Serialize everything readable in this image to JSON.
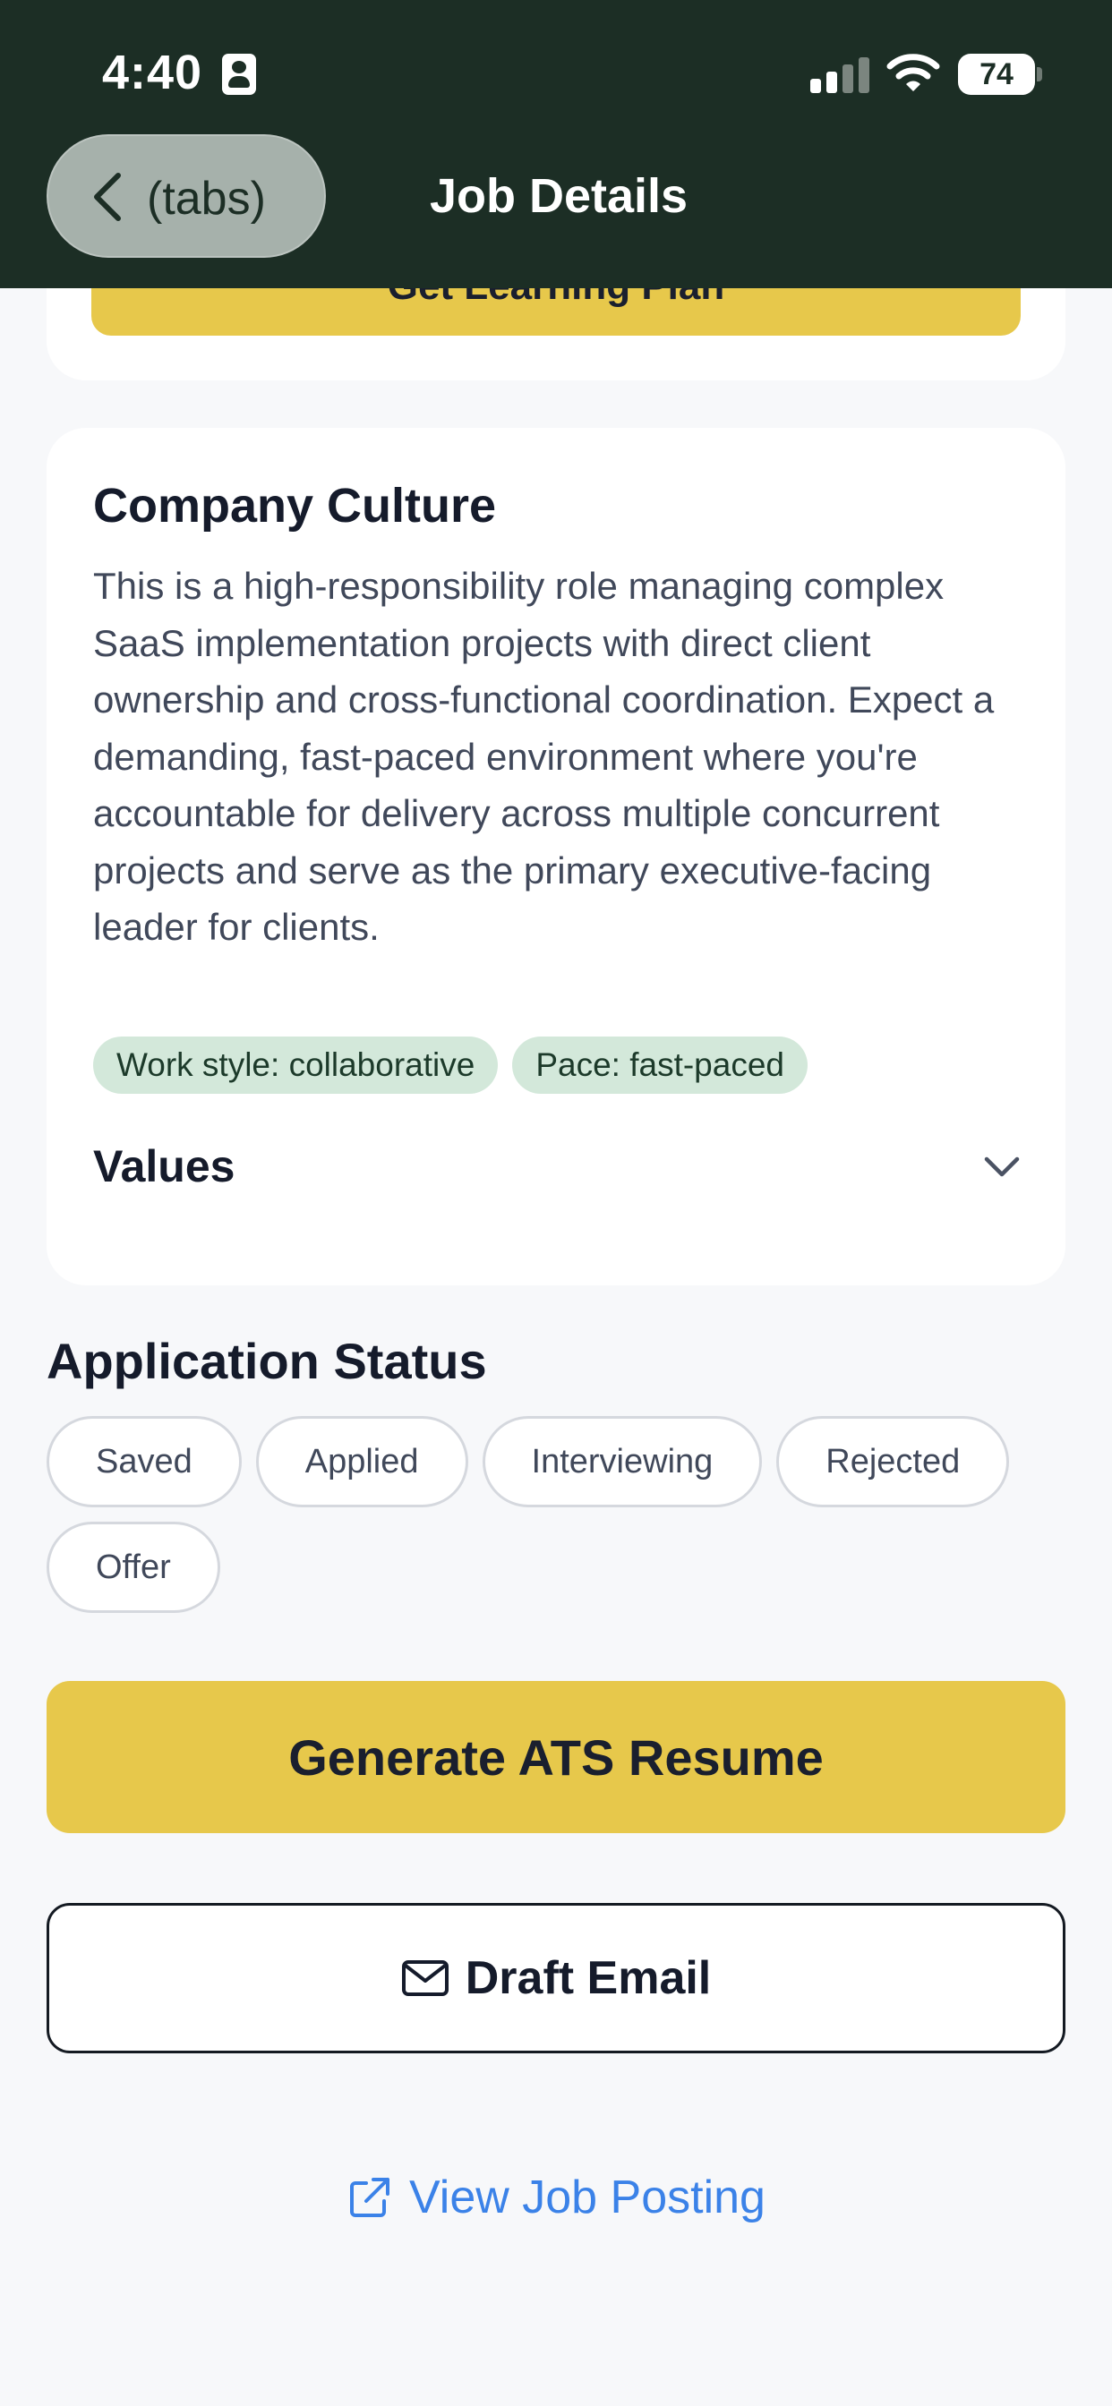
{
  "status_bar": {
    "time": "4:40",
    "battery": "74"
  },
  "header": {
    "back_label": "(tabs)",
    "title": "Job Details"
  },
  "learning": {
    "button_label": "Get Learning Plan"
  },
  "culture": {
    "title": "Company Culture",
    "description": "This is a high-responsibility role managing complex SaaS implementation projects with direct client ownership and cross-functional coordination. Expect a demanding, fast-paced environment where you're accountable for delivery across multiple concurrent projects and serve as the primary executive-facing leader for clients.",
    "tags": [
      "Work style: collaborative",
      "Pace: fast-paced"
    ],
    "values_label": "Values"
  },
  "application_status": {
    "heading": "Application Status",
    "options": [
      "Saved",
      "Applied",
      "Interviewing",
      "Rejected",
      "Offer"
    ]
  },
  "actions": {
    "ats_label": "Generate ATS Resume",
    "email_label": "Draft Email",
    "view_posting_label": "View Job Posting"
  },
  "colors": {
    "header_bg": "#1c2e25",
    "accent_yellow": "#e7c84b",
    "tag_green": "#d3e8da",
    "link_blue": "#3b82e8"
  },
  "icons": {
    "back": "chevron-left-icon",
    "values": "chevron-down-icon",
    "email": "mail-icon",
    "posting": "external-link-icon"
  }
}
